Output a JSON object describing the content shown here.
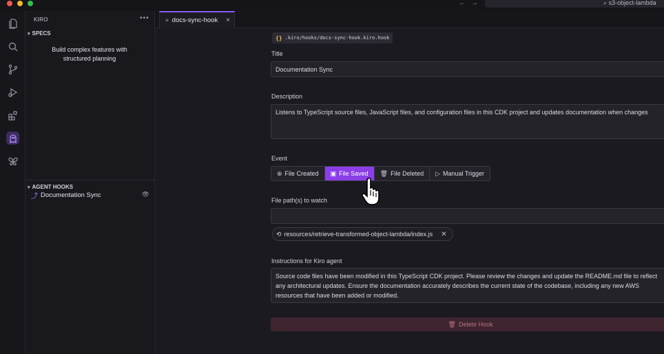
{
  "window": {
    "search_text": "s3-object-lambda"
  },
  "activity_bar": {
    "icons": [
      "files-icon",
      "search-icon",
      "source-control-icon",
      "run-debug-icon",
      "extensions-icon",
      "kiro-ghost-icon",
      "butterfly-icon"
    ]
  },
  "sidebar": {
    "title": "KIRO",
    "menu": "•••",
    "specs": {
      "header": "SPECS",
      "description_line1": "Build complex features with",
      "description_line2": "structured planning"
    },
    "agent_hooks": {
      "header": "AGENT HOOKS",
      "items": [
        {
          "label": "Documentation Sync"
        }
      ]
    }
  },
  "tabs": [
    {
      "label": "docs-sync-hook",
      "close": "×"
    }
  ],
  "hook_editor": {
    "file_path": ".kiro/hooks/docs-sync-hook.kiro.hook",
    "title_label": "Title",
    "title_value": "Documentation Sync",
    "description_label": "Description",
    "description_value": "Listens to TypeScript source files, JavaScript files, and configuration files in this CDK project and updates documentation when changes",
    "event_label": "Event",
    "events": [
      {
        "label": "File Created",
        "selected": false
      },
      {
        "label": "File Saved",
        "selected": true
      },
      {
        "label": "File Deleted",
        "selected": false
      },
      {
        "label": "Manual Trigger",
        "selected": false
      }
    ],
    "watch_label": "File path(s) to watch",
    "watch_value": "",
    "watch_patterns": [
      {
        "label": "resources/retrieve-transformed-object-lambda/index.js"
      }
    ],
    "instructions_label": "Instructions for Kiro agent",
    "instructions_value": "Source code files have been modified in this TypeScript CDK project. Please review the changes and update the README.md file to reflect any architectural updates. Ensure the documentation accurately describes the current state of the codebase, including any new AWS resources that have been added or modified.",
    "delete_label": "Delete Hook"
  },
  "colors": {
    "accent": "#8b3ee8",
    "danger_bg": "#3e2530",
    "danger_text": "#b8727f"
  }
}
